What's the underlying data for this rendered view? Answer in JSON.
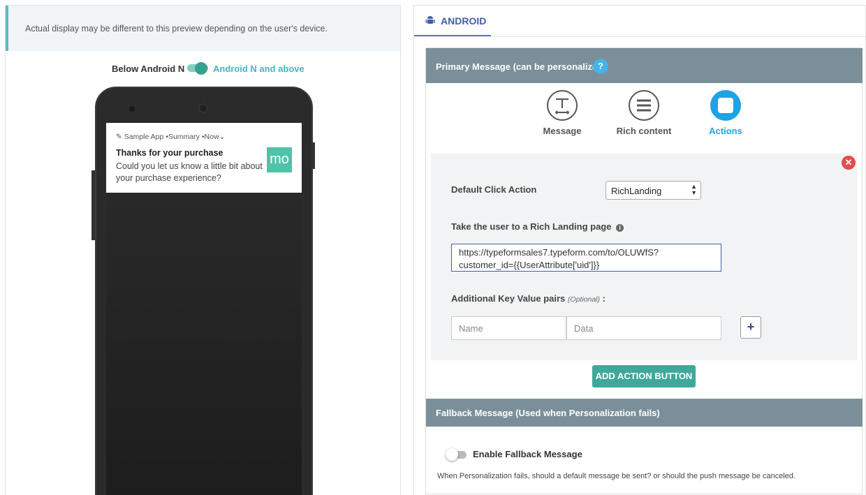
{
  "preview": {
    "notice": "Actual display may be different to this preview depending on the user's device.",
    "below_label": "Below Android N",
    "above_label": "Android N and above",
    "toggle_on": true,
    "notification": {
      "app_name": "Sample App",
      "summary": "Summary",
      "time": "Now",
      "title": "Thanks for your purchase",
      "body": "Could you let us know a little bit about your purchase experience?",
      "logo_text": "mo"
    }
  },
  "tabs": [
    {
      "label": "ANDROID",
      "icon": "android-icon"
    }
  ],
  "primary": {
    "header": "Primary Message (can be personalized)",
    "help": "?",
    "modes": [
      {
        "label": "Message",
        "icon": "text-format-icon"
      },
      {
        "label": "Rich content",
        "icon": "list-icon"
      },
      {
        "label": "Actions",
        "icon": "square-icon"
      }
    ],
    "default_click_label": "Default Click Action",
    "default_click_value": "RichLanding",
    "rich_landing_label": "Take the user to a Rich Landing page",
    "url_value": "https://typeformsales7.typeform.com/to/OLUWfS?customer_id={{UserAttribute['uid']}}",
    "url_line1": "https://typeformsales7.typeform.com/to/OLUWfS?",
    "url_line2": "customer_id={{UserAttribute['uid']}}",
    "kv_label": "Additional Key Value pairs",
    "kv_optional": "(Optional)",
    "kv_colon": ":",
    "name_placeholder": "Name",
    "data_placeholder": "Data",
    "plus": "+",
    "add_action": "ADD ACTION BUTTON"
  },
  "fallback": {
    "header": "Fallback Message (Used when Personalization fails)",
    "toggle_label": "Enable Fallback Message",
    "toggle_on": false,
    "note": "When Personalization fails, should a default message be sent? or should the push message be canceled."
  },
  "colors": {
    "accent": "#3fa89a",
    "tab_blue": "#3f5fa8",
    "header_gray": "#7a8f99",
    "active_blue": "#1ea3e4"
  }
}
